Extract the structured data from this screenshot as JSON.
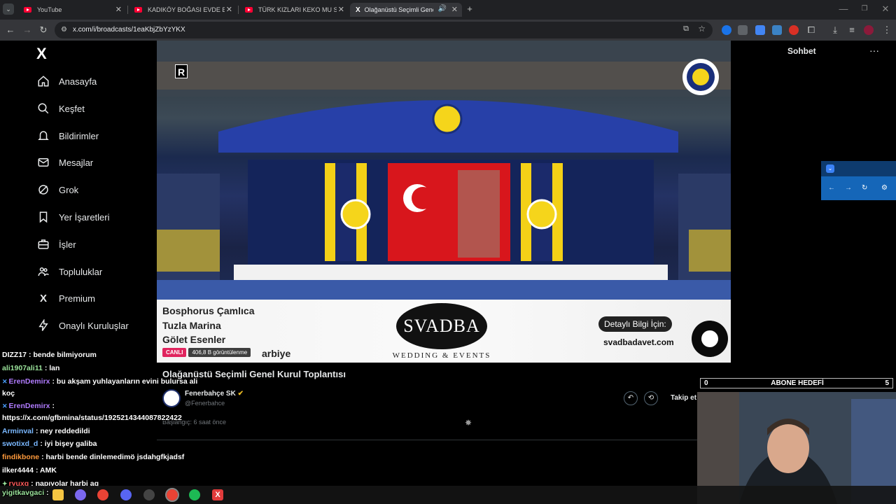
{
  "browser": {
    "tabs": [
      {
        "title": "YouTube",
        "active": false
      },
      {
        "title": "KADIKÖY BOĞASI EVDE BİR GÜ",
        "active": false
      },
      {
        "title": "TÜRK KIZLARI KEKO MU SEVİYO",
        "active": false
      },
      {
        "title": "Olağanüstü Seçimli Genel K",
        "active": true
      }
    ],
    "url": "x.com/i/broadcasts/1eaKbjZbYzYKX"
  },
  "sidebar": {
    "logo": "X",
    "items": [
      {
        "label": "Anasayfa",
        "icon": "home-icon"
      },
      {
        "label": "Keşfet",
        "icon": "search-icon"
      },
      {
        "label": "Bildirimler",
        "icon": "bell-icon"
      },
      {
        "label": "Mesajlar",
        "icon": "mail-icon"
      },
      {
        "label": "Grok",
        "icon": "grok-icon"
      },
      {
        "label": "Yer İşaretleri",
        "icon": "bookmark-icon"
      },
      {
        "label": "İşler",
        "icon": "briefcase-icon"
      },
      {
        "label": "Topluluklar",
        "icon": "people-icon"
      },
      {
        "label": "Premium",
        "icon": "x-icon"
      },
      {
        "label": "Onaylı Kuruluşlar",
        "icon": "lightning-icon"
      }
    ]
  },
  "video": {
    "watermark": "R",
    "banner": {
      "lines": [
        "Bosphorus Çamlıca",
        "Tuzla Marina",
        "Gölet Esenler",
        "arbiye"
      ],
      "brand": "SVADBA",
      "brand_sub": "WEDDING & EVENTS",
      "cta": "Detaylı Bilgi İçin:",
      "site": "svadbadavet.com"
    },
    "live_label": "CANLI",
    "views": "406,8 B görüntülenme"
  },
  "broadcast": {
    "title": "Olağanüstü Seçimli Genel Kurul Toplantısı",
    "account_name": "Fenerbahçe SK",
    "account_handle": "@Fenerbahce",
    "started": "Başlangıç: 6 saat önce",
    "follow_label": "Takip et"
  },
  "right_panel": {
    "title": "Sohbet",
    "more": "···"
  },
  "overlay": {
    "goal_left": "0",
    "goal_label": "ABONE HEDEFİ",
    "goal_right": "5",
    "chat": [
      {
        "user": "DIZZ17",
        "msg": "bende bilmiyorum",
        "color": "#ffffff",
        "badge": ""
      },
      {
        "user": "ali1907ali11",
        "msg": "lan",
        "color": "#9be39b",
        "badge": ""
      },
      {
        "user": "ErenDemirx",
        "msg": "bu akşam yuhlayanların evini bulursa ali",
        "color": "#b17cff",
        "badge": "✕"
      },
      {
        "user": "",
        "msg": "koç",
        "color": "#ffffff",
        "badge": ""
      },
      {
        "user": "ErenDemirx",
        "msg": "",
        "color": "#b17cff",
        "badge": "✕"
      },
      {
        "user": "",
        "msg": "https://x.com/gfbmina/status/1925214344087822422",
        "color": "#ffffff",
        "badge": ""
      },
      {
        "user": "Arminval",
        "msg": "ney reddedildi",
        "color": "#7ab8ff",
        "badge": ""
      },
      {
        "user": "swotixd_d",
        "msg": "iyi bişey galiba",
        "color": "#7ab8ff",
        "badge": ""
      },
      {
        "user": "findikbone",
        "msg": "harbi bende dinlemedimö jsdahgfkjadsf",
        "color": "#ff9a3c",
        "badge": ""
      },
      {
        "user": "ilker4444",
        "msg": "AMK",
        "color": "#ffffff",
        "badge": ""
      },
      {
        "user": "ryuxq",
        "msg": "napıyolar harbi aq",
        "color": "#ff5a5a",
        "badge": "✦"
      },
      {
        "user": "yigitkavgaci",
        "msg": "",
        "color": "#9be39b",
        "badge": ""
      }
    ]
  },
  "colors": {
    "accent": "#1d9bf0",
    "live": "#e0245e"
  }
}
